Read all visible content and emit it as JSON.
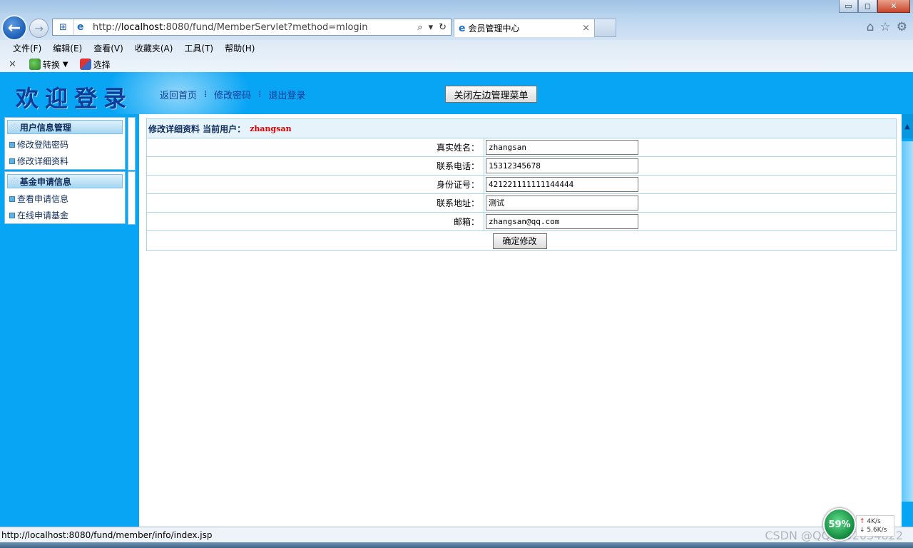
{
  "browser": {
    "url_prefix": "http://",
    "url_host": "localhost",
    "url_rest": ":8080/fund/MemberServlet?method=mlogin",
    "tab_title": "会员管理中心",
    "tab_close": "×",
    "window_controls": {
      "minimize": "▭",
      "restore": "◻",
      "close": "✕"
    },
    "menu": [
      "文件(F)",
      "编辑(E)",
      "查看(V)",
      "收藏夹(A)",
      "工具(T)",
      "帮助(H)"
    ],
    "command_bar": {
      "close": "✕",
      "convert": "转换",
      "select": "选择"
    },
    "icons": {
      "home": "⌂",
      "favorites": "☆",
      "settings": "⚙"
    }
  },
  "header": {
    "welcome": "欢迎登录",
    "links": [
      "返回首页",
      "修改密码",
      "退出登录"
    ],
    "separator": "⁞",
    "toggle_button": "关闭左边管理菜单"
  },
  "sidebar": {
    "groups": [
      {
        "title": "用户信息管理",
        "items": [
          "修改登陆密码",
          "修改详细资料"
        ]
      },
      {
        "title": "基金申请信息",
        "items": [
          "查看申请信息",
          "在线申请基金"
        ]
      }
    ]
  },
  "form": {
    "heading": "修改详细资料  当前用户：",
    "current_user": "zhangsan",
    "fields": [
      {
        "label": "真实姓名：",
        "value": "zhangsan"
      },
      {
        "label": "联系电话：",
        "value": "15312345678"
      },
      {
        "label": "身份证号：",
        "value": "421221111111144444"
      },
      {
        "label": "联系地址：",
        "value": "测试"
      },
      {
        "label": "邮箱：",
        "value": "zhangsan@qq.com"
      }
    ],
    "submit": "确定修改"
  },
  "statusbar": {
    "url": "http://localhost:8080/fund/member/info/index.jsp",
    "watermark": "CSDN @QQ2892034822"
  },
  "netmonitor": {
    "percent": "59%",
    "up": "4K/s",
    "down": "5.6K/s"
  }
}
